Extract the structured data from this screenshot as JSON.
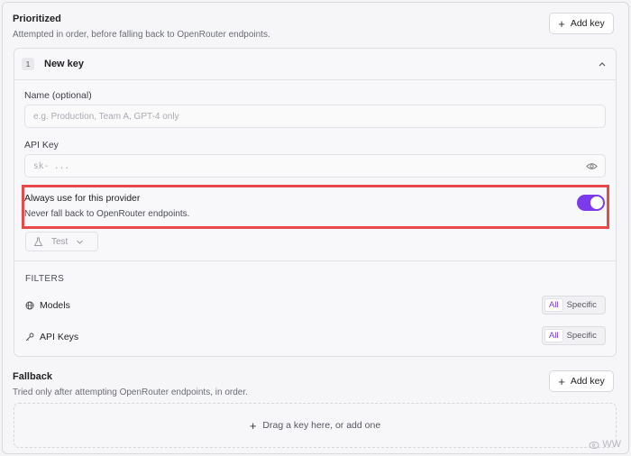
{
  "prioritized": {
    "title": "Prioritized",
    "subtitle": "Attempted in order, before falling back to OpenRouter endpoints.",
    "add_label": "Add key"
  },
  "key": {
    "index": "1",
    "name": "New key",
    "name_label": "Name (optional)",
    "name_placeholder": "e.g. Production, Team A, GPT-4 only",
    "api_label": "API Key",
    "api_placeholder": "sk- ...",
    "always_title": "Always use for this provider",
    "always_sub": "Never fall back to OpenRouter endpoints.",
    "always_on": true,
    "test_label": "Test"
  },
  "filters": {
    "label": "FILTERS",
    "rows": [
      {
        "label": "Models",
        "icon": "globe-icon",
        "options": [
          "All",
          "Specific"
        ],
        "selected": "All"
      },
      {
        "label": "API Keys",
        "icon": "key-icon",
        "options": [
          "All",
          "Specific"
        ],
        "selected": "All"
      }
    ]
  },
  "fallback": {
    "title": "Fallback",
    "subtitle": "Tried only after attempting OpenRouter endpoints, in order.",
    "add_label": "Add key",
    "drop_label": "Drag a key here, or add one"
  },
  "colors": {
    "accent": "#7c3aed",
    "highlight": "#e84a4c"
  },
  "watermark": "WW"
}
